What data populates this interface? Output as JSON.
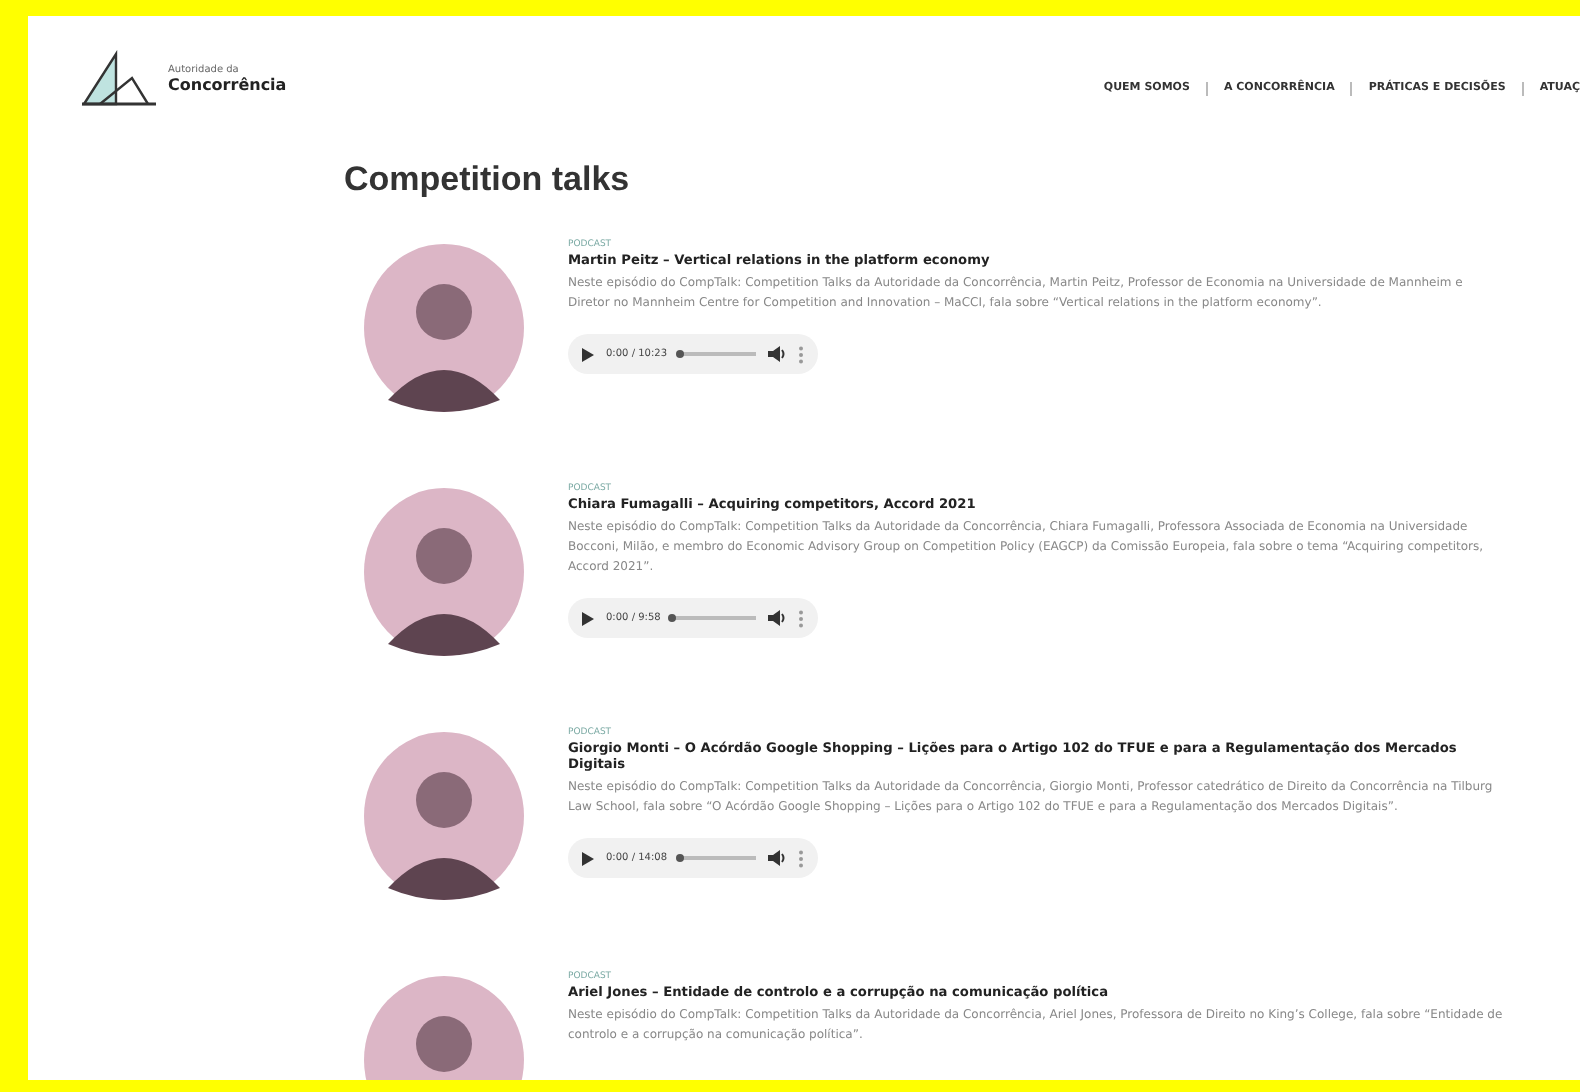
{
  "logo": {
    "line_1": "Autoridade da",
    "line_2": "Concorrência"
  },
  "nav": [
    "QUEM SOMOS",
    "A CONCORRÊNCIA",
    "PRÁTICAS E DECISÕES",
    "ATUAÇ"
  ],
  "heading": "Competition talks",
  "talks": [
    {
      "tag": "PODCAST",
      "title": "Martin Peitz – Vertical relations in the platform economy",
      "description": "Neste episódio do CompTalk: Competition Talks da Autoridade da Concorrência, Martin Peitz, Professor de Economia na Universidade de Mannheim e Diretor no Mannheim Centre for Competition and Innovation – MaCCI, fala sobre “Vertical relations in the platform economy”.",
      "time": "0:00 / 10:23",
      "level": 0
    },
    {
      "tag": "PODCAST",
      "title": "Chiara Fumagalli – Acquiring competitors, Accord 2021",
      "description": "Neste episódio do CompTalk: Competition Talks da Autoridade da Concorrência, Chiara Fumagalli, Professora Associada de Economia na Universidade Bocconi, Milão, e membro do Economic Advisory Group on Competition Policy (EAGCP) da Comissão Europeia, fala sobre o tema “Acquiring competitors, Accord 2021”.",
      "time": "0:00 / 9:58",
      "level": 0
    },
    {
      "tag": "PODCAST",
      "title": "Giorgio Monti – O Acórdão Google Shopping – Lições para o Artigo 102 do TFUE e para a Regulamentação dos Mercados Digitais",
      "description": "Neste episódio do CompTalk: Competition Talks da Autoridade da Concorrência, Giorgio Monti, Professor catedrático de Direito da Concorrência na Tilburg Law School, fala sobre “O Acórdão Google Shopping – Lições para o Artigo 102 do TFUE e para a Regulamentação dos Mercados Digitais”.",
      "time": "0:00 / 14:08",
      "level": 0
    },
    {
      "tag": "PODCAST",
      "title": "Ariel Jones – Entidade de controlo e a corrupção na comunicação política",
      "description": "Neste episódio do CompTalk: Competition Talks da Autoridade da Concorrência, Ariel Jones, Professora de Direito no King’s College, fala sobre “Entidade de controlo e a corrupção na comunicação política”."
    }
  ]
}
